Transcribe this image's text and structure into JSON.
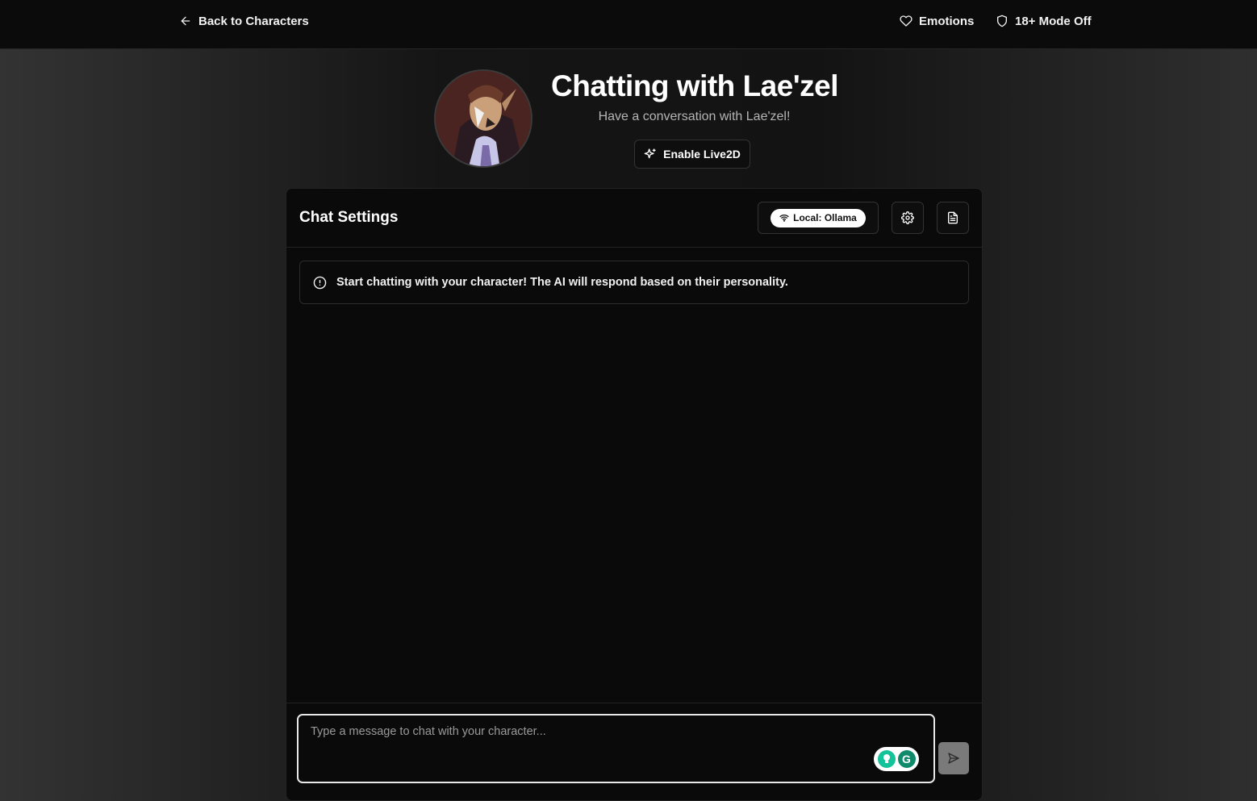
{
  "nav": {
    "back_label": "Back to Characters",
    "emotions_label": "Emotions",
    "mode_label": "18+ Mode Off"
  },
  "header": {
    "title": "Chatting with Lae'zel",
    "subtitle": "Have a conversation with Lae'zel!",
    "live2d_label": "Enable Live2D"
  },
  "panel": {
    "title": "Chat Settings",
    "provider_label": "Local: Ollama",
    "notice": "Start chatting with your character! The AI will respond based on their personality."
  },
  "composer": {
    "placeholder": "Type a message to chat with your character...",
    "value": ""
  },
  "colors": {
    "background": "#131313",
    "panel": "#0a0a0a",
    "accent": "#ffffff",
    "send_disabled": "#7a7a7a",
    "grammarly": "#15c39a"
  },
  "icons": {
    "back": "arrow-left-icon",
    "emotions": "heart-icon",
    "mode": "shield-icon",
    "live2d": "sparkles-icon",
    "provider": "wifi-icon",
    "settings": "gear-icon",
    "document": "file-text-icon",
    "notice": "alert-circle-icon",
    "send": "send-icon"
  }
}
